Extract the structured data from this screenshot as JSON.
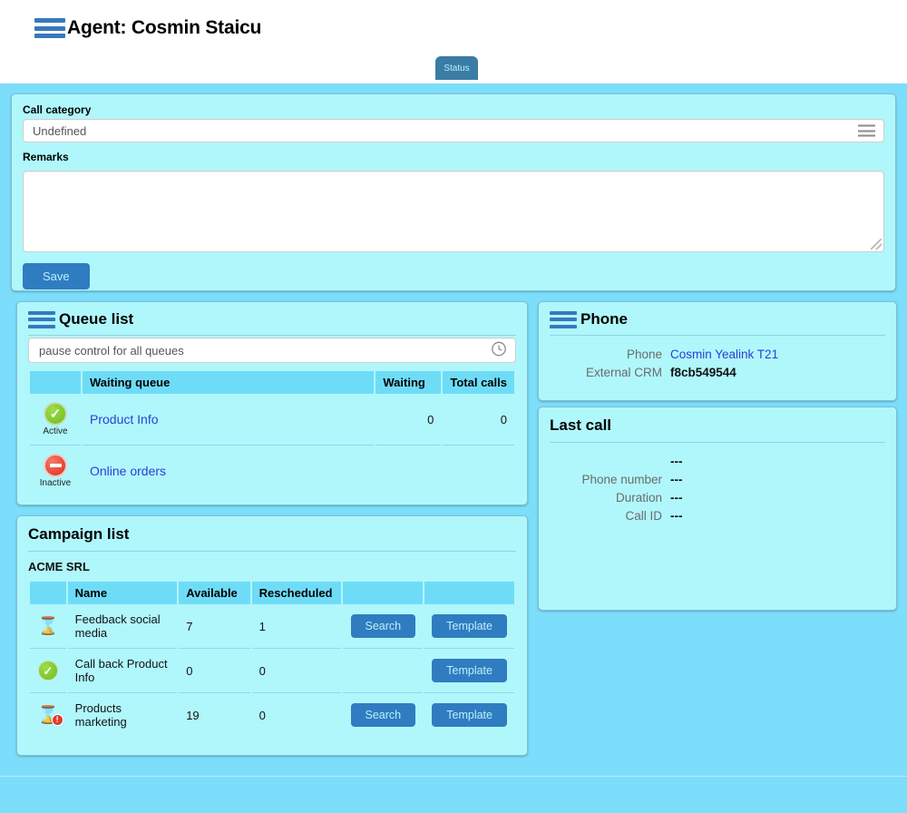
{
  "header": {
    "title": "Agent: Cosmin Staicu",
    "menu_icon": "hamburger-icon"
  },
  "tabs": [
    {
      "label": "Status",
      "active": true
    }
  ],
  "status_form": {
    "call_category_label": "Call category",
    "call_category_value": "Undefined",
    "call_category_icon": "list-menu-icon",
    "remarks_label": "Remarks",
    "remarks_value": "",
    "remarks_placeholder": "",
    "save_label": "Save"
  },
  "queue_list": {
    "title": "Queue list",
    "menu_icon": "hamburger-icon",
    "pause_control_value": "pause control for all queues",
    "pause_icon": "clock-icon",
    "columns": [
      "",
      "Waiting queue",
      "Waiting",
      "Total calls"
    ],
    "rows": [
      {
        "state_icon": "check-circle-icon",
        "state_label": "Active",
        "name": "Product Info",
        "waiting": "0",
        "total_calls": "0"
      },
      {
        "state_icon": "minus-circle-icon",
        "state_label": "Inactive",
        "name": "Online orders",
        "waiting": "",
        "total_calls": ""
      }
    ]
  },
  "campaign_list": {
    "title": "Campaign list",
    "organization": "ACME SRL",
    "columns": [
      "",
      "Name",
      "Available",
      "Rescheduled",
      "",
      ""
    ],
    "rows": [
      {
        "state_icon": "hourglass-icon",
        "name": "Feedback social media",
        "available": "7",
        "rescheduled": "1",
        "search_label": "Search",
        "template_label": "Template",
        "has_search": true
      },
      {
        "state_icon": "check-circle-icon",
        "name": "Call back Product Info",
        "available": "0",
        "rescheduled": "0",
        "search_label": "",
        "template_label": "Template",
        "has_search": false
      },
      {
        "state_icon": "hourglass-alert-icon",
        "name": "Products marketing",
        "available": "19",
        "rescheduled": "0",
        "search_label": "Search",
        "template_label": "Template",
        "has_search": true
      }
    ]
  },
  "phone": {
    "title": "Phone",
    "menu_icon": "hamburger-icon",
    "phone_label": "Phone",
    "phone_value": "Cosmin Yealink T21",
    "crm_label": "External CRM",
    "crm_value": "f8cb549544"
  },
  "last_call": {
    "title": "Last call",
    "rows": [
      {
        "label": "",
        "value": "---"
      },
      {
        "label": "Phone number",
        "value": "---"
      },
      {
        "label": "Duration",
        "value": "---"
      },
      {
        "label": "Call ID",
        "value": "---"
      }
    ]
  },
  "colors": {
    "page_background": "#7cdefb",
    "panel_background": "#b0f7fc",
    "accent_blue": "#2f7dc0",
    "link_blue": "#2b3fd4",
    "header_rule": "#3778be",
    "tab_active": "#3a7ca5",
    "status_active": "#6ebb18",
    "status_inactive": "#e02b1c"
  }
}
